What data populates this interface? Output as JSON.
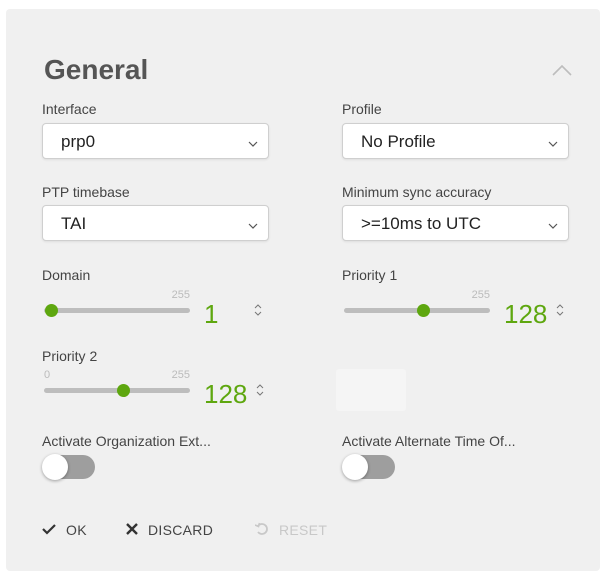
{
  "panel": {
    "title": "General"
  },
  "fields": {
    "interface": {
      "label": "Interface",
      "value": "prp0"
    },
    "profile": {
      "label": "Profile",
      "value": "No Profile"
    },
    "ptp_timebase": {
      "label": "PTP timebase",
      "value": "TAI"
    },
    "min_sync_accuracy": {
      "label": "Minimum sync accuracy",
      "value": ">=10ms to UTC"
    }
  },
  "sliders": {
    "domain": {
      "label": "Domain",
      "min_label": "",
      "max_label": "255",
      "value": "1",
      "fraction": 0.004
    },
    "priority1": {
      "label": "Priority 1",
      "min_label": "",
      "max_label": "255",
      "value": "128",
      "fraction": 0.502
    },
    "priority2": {
      "label": "Priority 2",
      "min_label": "0",
      "max_label": "255",
      "value": "128",
      "fraction": 0.502
    }
  },
  "toggles": {
    "org_ext": {
      "label": "Activate Organization Ext...",
      "on": false
    },
    "alt_time": {
      "label": "Activate Alternate Time Of...",
      "on": false
    }
  },
  "actions": {
    "ok": "OK",
    "discard": "DISCARD",
    "reset": "RESET"
  },
  "colors": {
    "accent": "#5ea70f",
    "toggle_off": "#9e9e9e",
    "card_bg": "#f0f0f0"
  },
  "icons": [
    "chevron-up-icon",
    "chevron-down-icon",
    "spinner-icon",
    "check-icon",
    "x-icon",
    "undo-icon"
  ]
}
